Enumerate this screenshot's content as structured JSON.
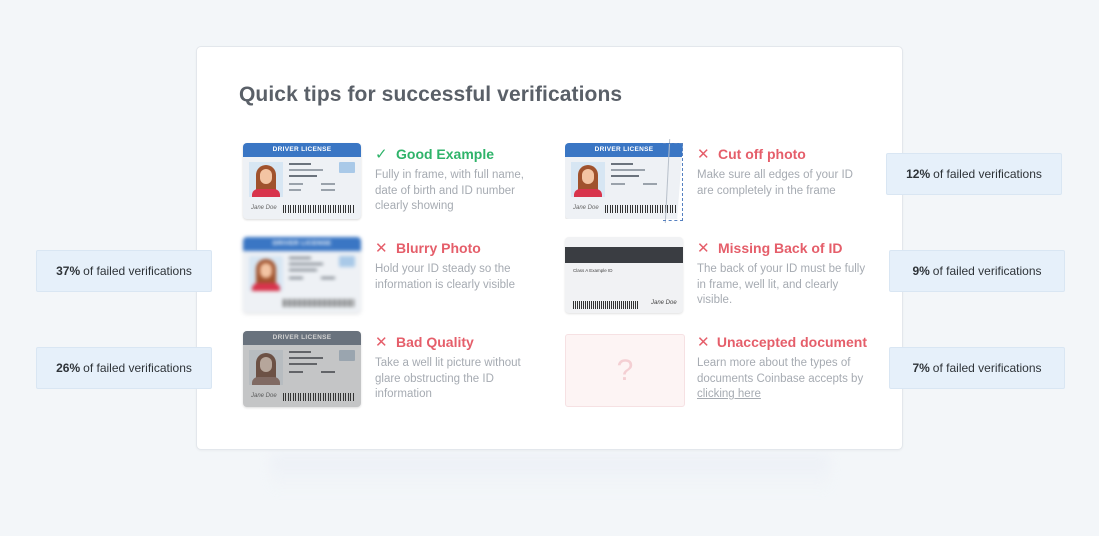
{
  "panel": {
    "title": "Quick tips for successful verifications"
  },
  "tips": [
    {
      "status": "good",
      "icon": "check-icon",
      "mark": "✓",
      "title": "Good Example",
      "description": "Fully in frame, with full name, date of birth and ID number clearly showing",
      "image": "id-card-good"
    },
    {
      "status": "bad",
      "icon": "cross-icon",
      "mark": "✕",
      "title": "Blurry Photo",
      "description": "Hold your ID steady so the information is clearly visible",
      "image": "id-card-blurry"
    },
    {
      "status": "bad",
      "icon": "cross-icon",
      "mark": "✕",
      "title": "Bad Quality",
      "description": "Take a well lit picture without glare obstructing the ID information",
      "image": "id-card-bad-quality"
    },
    {
      "status": "bad",
      "icon": "cross-icon",
      "mark": "✕",
      "title": "Cut off photo",
      "description": "Make sure all edges of your ID are completely in the frame",
      "image": "id-card-cut-off"
    },
    {
      "status": "bad",
      "icon": "cross-icon",
      "mark": "✕",
      "title": "Missing Back of ID",
      "description": "The back of your ID must be fully in frame, well lit, and clearly visible.",
      "image": "id-card-back"
    },
    {
      "status": "bad",
      "icon": "cross-icon",
      "mark": "✕",
      "title": "Unaccepted document",
      "description_prefix": "Learn more about the types of documents Coinbase accepts by ",
      "link_text": "clicking here",
      "image": "unknown-document"
    }
  ],
  "card": {
    "band_label": "DRIVER LICENSE",
    "signature": "Jane Doe",
    "back_text": "Class A Example ID",
    "unknown_glyph": "?"
  },
  "stats": [
    {
      "value": "37%",
      "label": "of failed verifications",
      "tip": "Blurry Photo"
    },
    {
      "value": "26%",
      "label": "of failed verifications",
      "tip": "Bad Quality"
    },
    {
      "value": "12%",
      "label": "of failed verifications",
      "tip": "Cut off photo"
    },
    {
      "value": "9%",
      "label": "of failed verifications",
      "tip": "Missing Back of ID"
    },
    {
      "value": "7%",
      "label": "of failed verifications",
      "tip": "Unaccepted document"
    }
  ],
  "colors": {
    "good": "#2fb36a",
    "bad": "#e55e6a",
    "stat_bg": "#e6f0fa",
    "card_band": "#3a76c4"
  }
}
